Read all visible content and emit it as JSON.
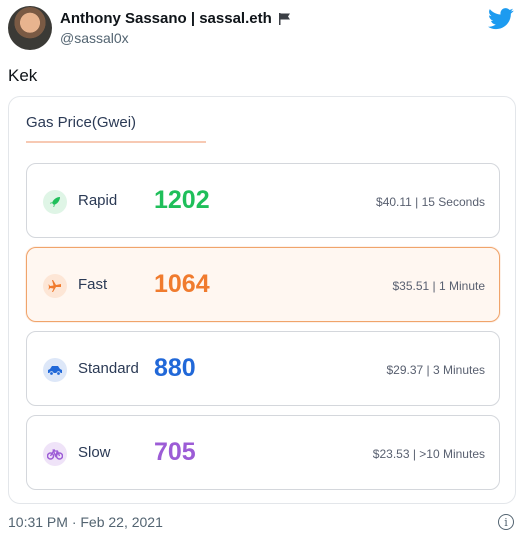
{
  "tweet": {
    "display_name": "Anthony Sassano | sassal.eth",
    "handle": "@sassal0x",
    "text": "Kek",
    "timestamp": "10:31 PM · Feb 22, 2021"
  },
  "card": {
    "title": "Gas Price(Gwei)",
    "rows": [
      {
        "label": "Rapid",
        "value": "1202",
        "detail": "$40.11 | 15 Seconds",
        "color": "#1fbf5a",
        "icon": "rocket-icon",
        "icon_bg": "#dff5e6",
        "active": false
      },
      {
        "label": "Fast",
        "value": "1064",
        "detail": "$35.51 | 1 Minute",
        "color": "#f07b2e",
        "icon": "plane-icon",
        "icon_bg": "#fde6d6",
        "active": true
      },
      {
        "label": "Standard",
        "value": "880",
        "detail": "$29.37 | 3 Minutes",
        "color": "#2168d8",
        "icon": "car-icon",
        "icon_bg": "#dde7f8",
        "active": false
      },
      {
        "label": "Slow",
        "value": "705",
        "detail": "$23.53 | >10 Minutes",
        "color": "#9c5cd6",
        "icon": "bicycle-icon",
        "icon_bg": "#efe3f8",
        "active": false
      }
    ]
  },
  "icons": {
    "flag": "flag-icon",
    "twitter": "twitter-bird-icon",
    "info": "info-icon"
  },
  "info_glyph": "i"
}
